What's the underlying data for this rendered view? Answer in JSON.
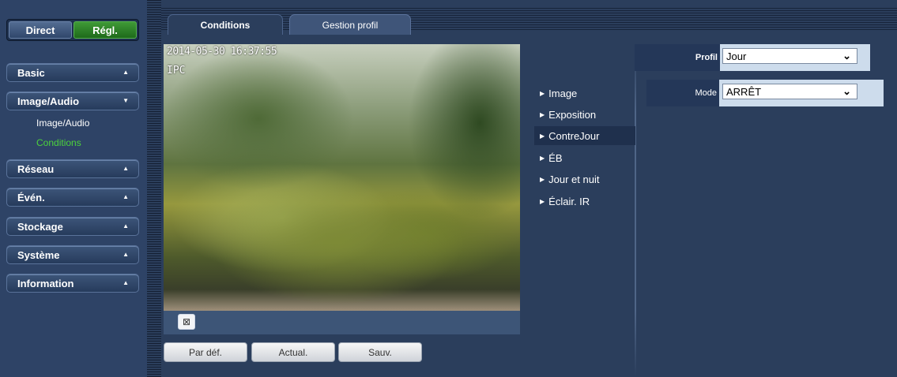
{
  "top_buttons": {
    "direct": "Direct",
    "regl": "Régl."
  },
  "sidebar": {
    "menus": [
      {
        "label": "Basic",
        "arrow": "▲"
      },
      {
        "label": "Image/Audio",
        "arrow": "▼"
      },
      {
        "label": "Réseau",
        "arrow": "▲"
      },
      {
        "label": "Évén.",
        "arrow": "▲"
      },
      {
        "label": "Stockage",
        "arrow": "▲"
      },
      {
        "label": "Système",
        "arrow": "▲"
      },
      {
        "label": "Information",
        "arrow": "▲"
      }
    ],
    "submenu": [
      {
        "label": "Image/Audio"
      },
      {
        "label": "Conditions"
      }
    ]
  },
  "tabs": [
    {
      "label": "Conditions"
    },
    {
      "label": "Gestion profil"
    }
  ],
  "video": {
    "timestamp": "2014-05-30 16:37:55",
    "channel": "IPC",
    "fullscreen_icon": "⊠"
  },
  "buttons": {
    "default": "Par déf.",
    "refresh": "Actual.",
    "save": "Sauv."
  },
  "settings_nav": [
    {
      "label": "Image"
    },
    {
      "label": "Exposition"
    },
    {
      "label": "ContreJour"
    },
    {
      "label": "ÉB"
    },
    {
      "label": "Jour et nuit"
    },
    {
      "label": "Éclair. IR"
    }
  ],
  "profile": {
    "label": "Profil",
    "value": "Jour"
  },
  "mode": {
    "label": "Mode",
    "value": "ARRÊT"
  },
  "colors": {
    "accent_green": "#4cd23c",
    "panel_bg": "#2b3e5c",
    "field_bg": "#cddcec"
  }
}
